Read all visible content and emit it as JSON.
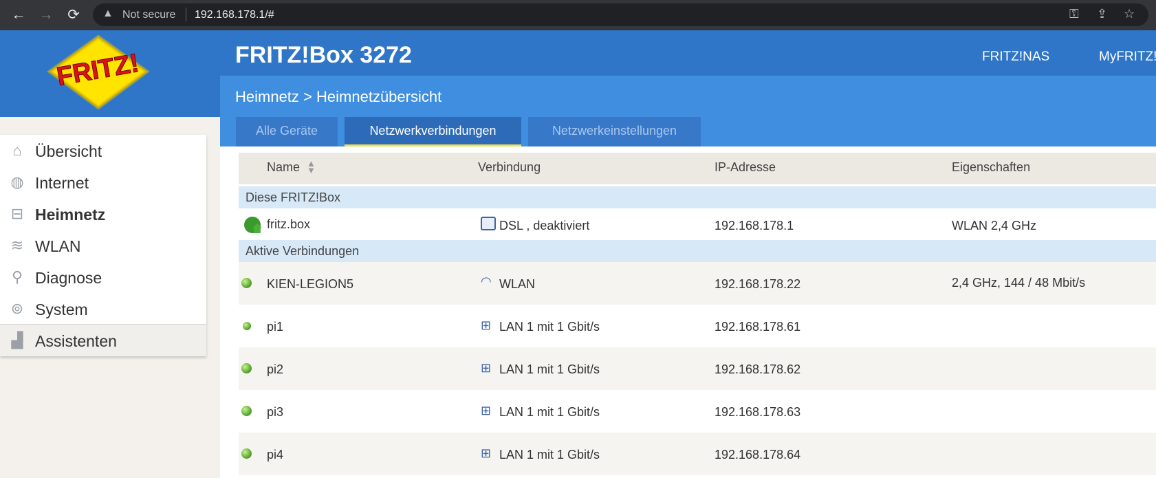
{
  "browser": {
    "security_label": "Not secure",
    "url": "192.168.178.1/#",
    "icons": [
      "back-icon",
      "forward-icon",
      "reload-icon",
      "warning-icon",
      "key-icon",
      "share-icon",
      "star-icon"
    ]
  },
  "logo": {
    "text": "FRITZ!"
  },
  "header": {
    "title": "FRITZ!Box 3272",
    "links": [
      "FRITZ!NAS",
      "MyFRITZ!"
    ]
  },
  "breadcrumb": {
    "parent": "Heimnetz",
    "separator": ">",
    "current": "Heimnetzübersicht"
  },
  "tabs": [
    {
      "label": "Alle Geräte",
      "active": false
    },
    {
      "label": "Netzwerkverbindungen",
      "active": true
    },
    {
      "label": "Netzwerkeinstellungen",
      "active": false
    }
  ],
  "sidebar": {
    "items": [
      {
        "label": "Übersicht",
        "icon": "home-icon"
      },
      {
        "label": "Internet",
        "icon": "globe-icon"
      },
      {
        "label": "Heimnetz",
        "icon": "network-icon",
        "active": true
      },
      {
        "label": "WLAN",
        "icon": "wifi-icon"
      },
      {
        "label": "Diagnose",
        "icon": "diagnose-icon"
      },
      {
        "label": "System",
        "icon": "system-icon"
      },
      {
        "label": "Assistenten",
        "icon": "assistant-icon"
      }
    ]
  },
  "table": {
    "columns": [
      "Name",
      "Verbindung",
      "IP-Adresse",
      "Eigenschaften"
    ],
    "groups": {
      "this_box": "Diese FRITZ!Box",
      "active": "Aktive Verbindungen"
    },
    "fritzbox_row": {
      "name": "fritz.box",
      "connection": "DSL , deaktiviert",
      "ip": "192.168.178.1",
      "properties": "WLAN 2,4 GHz"
    },
    "rows": [
      {
        "name": "KIEN-LEGION5",
        "connection": "WLAN",
        "ip": "192.168.178.22",
        "properties": "2,4 GHz, 144 / 48 Mbit/s",
        "conn_icon": "wifi-icon"
      },
      {
        "name": "pi1",
        "connection": "LAN 1 mit 1 Gbit/s",
        "ip": "192.168.178.61",
        "properties": "",
        "conn_icon": "lan-icon"
      },
      {
        "name": "pi2",
        "connection": "LAN 1 mit 1 Gbit/s",
        "ip": "192.168.178.62",
        "properties": "",
        "conn_icon": "lan-icon"
      },
      {
        "name": "pi3",
        "connection": "LAN 1 mit 1 Gbit/s",
        "ip": "192.168.178.63",
        "properties": "",
        "conn_icon": "lan-icon"
      },
      {
        "name": "pi4",
        "connection": "LAN 1 mit 1 Gbit/s",
        "ip": "192.168.178.64",
        "properties": "",
        "conn_icon": "lan-icon"
      }
    ]
  },
  "colors": {
    "header_blue": "#2f75c8",
    "subheader_blue": "#408ee0",
    "active_tab_underline": "#e8e25a",
    "group_row_bg": "#d7e8f7"
  }
}
